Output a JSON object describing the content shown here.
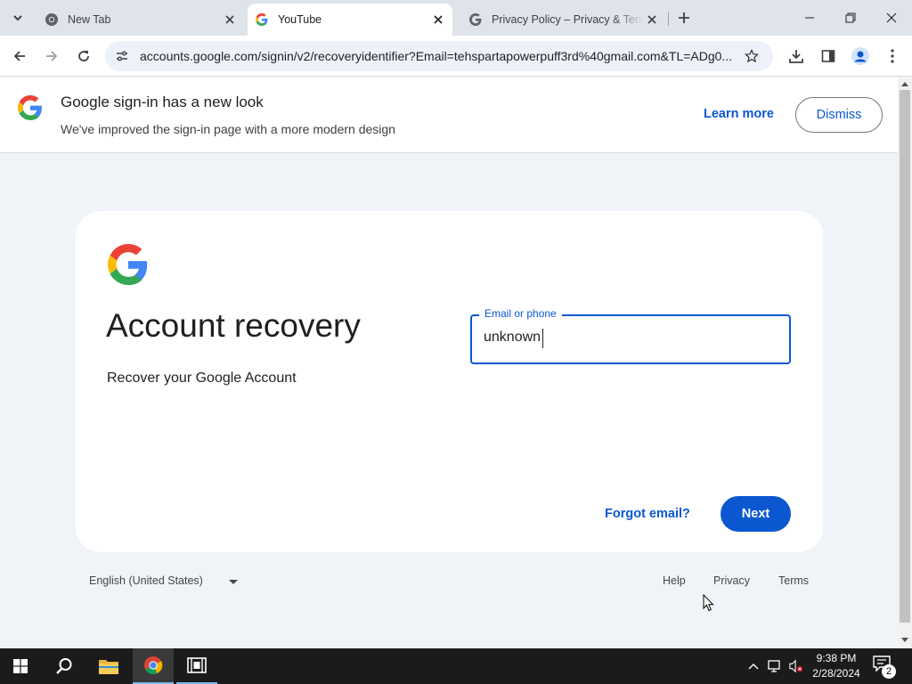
{
  "browser": {
    "tabs": [
      {
        "title": "New Tab",
        "active": false
      },
      {
        "title": "YouTube",
        "active": true
      },
      {
        "title": "Privacy Policy – Privacy & Terms",
        "active": false
      }
    ],
    "url": "accounts.google.com/signin/v2/recoveryidentifier?Email=tehspartapowerpuff3rd%40gmail.com&TL=ADg0..."
  },
  "banner": {
    "title": "Google sign-in has a new look",
    "subtitle": "We've improved the sign-in page with a more modern design",
    "learn_more": "Learn more",
    "dismiss": "Dismiss"
  },
  "card": {
    "heading": "Account recovery",
    "subheading": "Recover your Google Account",
    "field_label": "Email or phone",
    "field_value": "unknown",
    "forgot_email": "Forgot email?",
    "next": "Next"
  },
  "footer": {
    "language": "English (United States)",
    "help": "Help",
    "privacy": "Privacy",
    "terms": "Terms"
  },
  "taskbar": {
    "time": "9:38 PM",
    "date": "2/28/2024",
    "notification_count": "2"
  },
  "colors": {
    "accent": "#0b57d0",
    "page_bg": "#f0f4f9",
    "taskbar_bg": "#1b1b1b"
  }
}
